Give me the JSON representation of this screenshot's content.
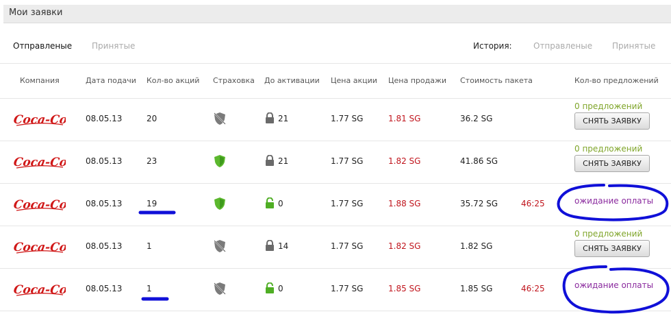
{
  "page": {
    "title": "Мои заявки"
  },
  "tabs": {
    "sent": "Отправленые",
    "accepted": "Принятые"
  },
  "history": {
    "label": "История:",
    "sent": "Отправленые",
    "accepted": "Принятые"
  },
  "columns": [
    "Компания",
    "Дата подачи",
    "Кол-во акций",
    "Страховка",
    "До активации",
    "Цена акции",
    "Цена продажи",
    "Стоимость пакета",
    "Кол-во предложений"
  ],
  "company_logo_text": "Coca-Cola",
  "rows": [
    {
      "date": "08.05.13",
      "qty": "20",
      "insurance": "none",
      "lock": "locked",
      "activation": "21",
      "price": "1.77 SG",
      "sale": "1.81 SG",
      "cost": "36.2 SG",
      "timer": "",
      "offers": "0 предложений",
      "action": "СНЯТЬ ЗАЯВКУ",
      "status": ""
    },
    {
      "date": "08.05.13",
      "qty": "23",
      "insurance": "insured",
      "lock": "locked",
      "activation": "21",
      "price": "1.77 SG",
      "sale": "1.82 SG",
      "cost": "41.86 SG",
      "timer": "",
      "offers": "0 предложений",
      "action": "СНЯТЬ ЗАЯВКУ",
      "status": ""
    },
    {
      "date": "08.05.13",
      "qty": "19",
      "insurance": "insured",
      "lock": "unlocked",
      "activation": "0",
      "price": "1.77 SG",
      "sale": "1.88 SG",
      "cost": "35.72 SG",
      "timer": "46:25",
      "offers": "",
      "action": "",
      "status": "ожидание оплаты"
    },
    {
      "date": "08.05.13",
      "qty": "1",
      "insurance": "none",
      "lock": "locked",
      "activation": "14",
      "price": "1.77 SG",
      "sale": "1.82 SG",
      "cost": "1.82 SG",
      "timer": "",
      "offers": "0 предложений",
      "action": "СНЯТЬ ЗАЯВКУ",
      "status": ""
    },
    {
      "date": "08.05.13",
      "qty": "1",
      "insurance": "none",
      "lock": "unlocked",
      "activation": "0",
      "price": "1.77 SG",
      "sale": "1.85 SG",
      "cost": "1.85 SG",
      "timer": "46:25",
      "offers": "",
      "action": "",
      "status": "ожидание оплаты"
    }
  ],
  "colors": {
    "sale_price": "#c0141c",
    "offers": "#7fa52a",
    "waiting": "#8a2a9e",
    "shield": "#5cb82e",
    "lock_open": "#5cb82e",
    "annotation": "#1010d8",
    "logo": "#d01818"
  }
}
